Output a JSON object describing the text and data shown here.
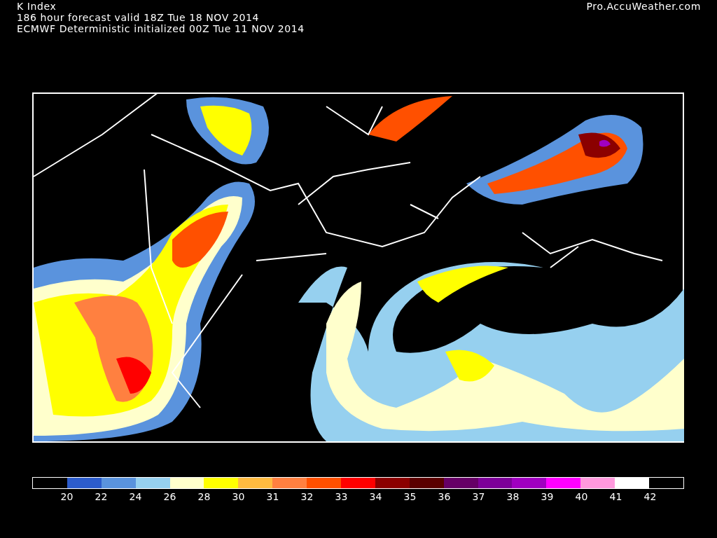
{
  "header": {
    "title": "K Index",
    "forecast": "186 hour forecast valid 18Z Tue 18 NOV 2014",
    "model": "ECMWF Deterministic initialized 00Z Tue 11 NOV 2014",
    "site": "Pro.AccuWeather.com"
  },
  "legend": {
    "bins": [
      {
        "color": "#000000"
      },
      {
        "color": "#2c5ccc"
      },
      {
        "color": "#5a93dd"
      },
      {
        "color": "#96d0ef"
      },
      {
        "color": "#ffffcc"
      },
      {
        "color": "#ffff00"
      },
      {
        "color": "#ffbb40"
      },
      {
        "color": "#ff8040"
      },
      {
        "color": "#ff5000"
      },
      {
        "color": "#ff0000"
      },
      {
        "color": "#8b0000"
      },
      {
        "color": "#5a0000"
      },
      {
        "color": "#660066"
      },
      {
        "color": "#7d0099"
      },
      {
        "color": "#a000c0"
      },
      {
        "color": "#ff00ff"
      },
      {
        "color": "#ff99dd"
      },
      {
        "color": "#ffffff"
      },
      {
        "color": "#000000"
      }
    ],
    "labels": [
      "20",
      "22",
      "24",
      "26",
      "28",
      "30",
      "31",
      "32",
      "33",
      "34",
      "35",
      "36",
      "37",
      "38",
      "39",
      "40",
      "41",
      "42"
    ]
  }
}
